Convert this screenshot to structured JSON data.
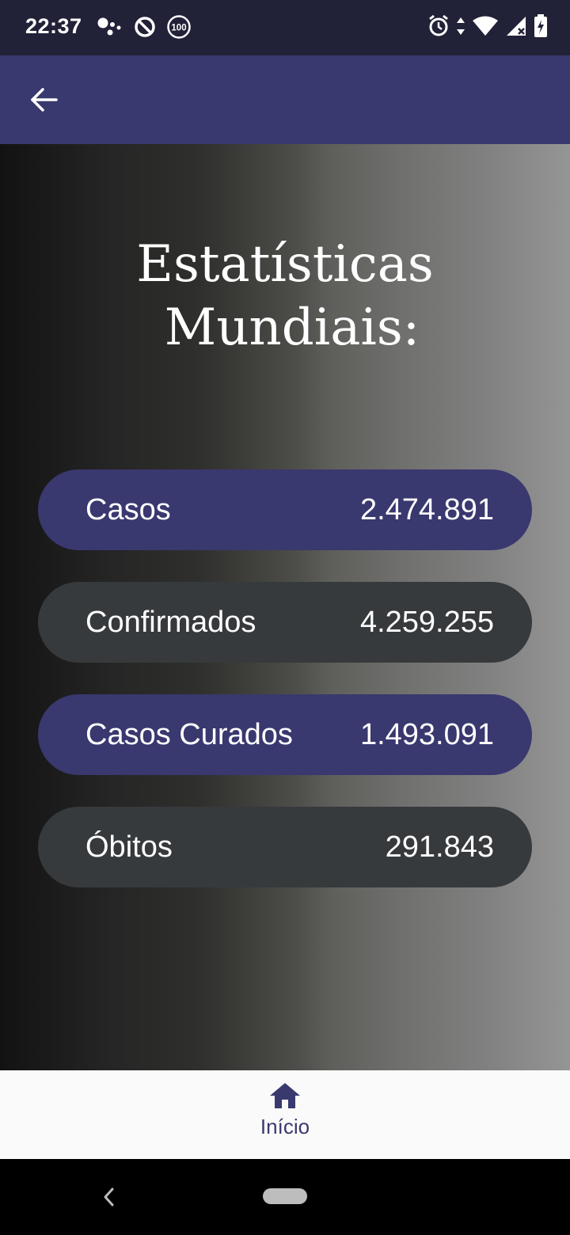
{
  "status_bar": {
    "time": "22:37",
    "badge": "100",
    "left_icons": [
      "assistant-icon",
      "data-saver-icon",
      "notification-count-icon"
    ],
    "right_icons": [
      "alarm-icon",
      "data-arrows-icon",
      "wifi-icon",
      "signal-icon",
      "battery-charging-icon"
    ]
  },
  "app_bar": {
    "back_icon": "arrow-left-icon"
  },
  "page": {
    "title_line1": "Estatísticas",
    "title_line2": "Mundiais:"
  },
  "stats": [
    {
      "label": "Casos",
      "value": "2.474.891",
      "color": "#39386f"
    },
    {
      "label": "Confirmados",
      "value": "4.259.255",
      "color": "#373a3c"
    },
    {
      "label": "Casos Curados",
      "value": "1.493.091",
      "color": "#39386f"
    },
    {
      "label": "Óbitos",
      "value": "291.843",
      "color": "#373a3c"
    }
  ],
  "bottom_nav": {
    "items": [
      {
        "label": "Início",
        "icon": "home-icon",
        "active": true
      }
    ],
    "active_color": "#39386f"
  },
  "colors": {
    "primary": "#39386f",
    "status_bar": "#212138",
    "pill_dark": "#373a3c"
  }
}
